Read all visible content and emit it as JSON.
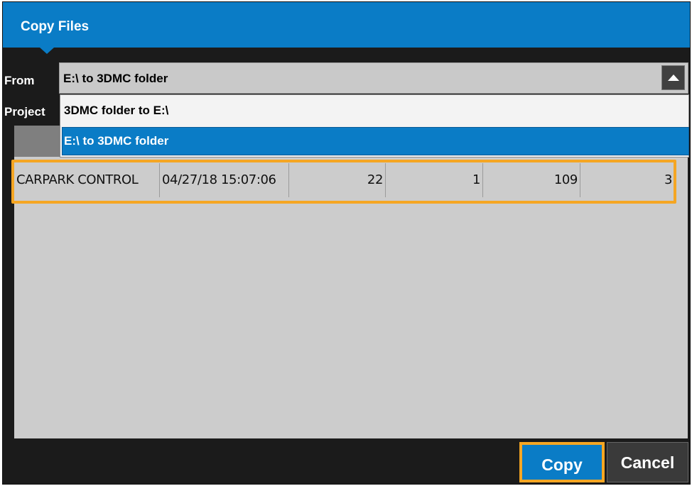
{
  "window": {
    "title": "Copy Files"
  },
  "from": {
    "label": "From",
    "selected_value": "E:\\ to 3DMC folder",
    "options": [
      "3DMC folder to E:\\",
      "E:\\ to 3DMC folder"
    ]
  },
  "project": {
    "label": "Project"
  },
  "grid": {
    "rows": [
      {
        "name": "CARPARK CONTROL",
        "date": "04/27/18 15:07:06",
        "c3": "22",
        "c4": "1",
        "c5": "109",
        "c6": "3"
      }
    ]
  },
  "buttons": {
    "copy": "Copy",
    "cancel": "Cancel"
  },
  "colors": {
    "accent": "#0a7cc6",
    "highlight": "#f5a623",
    "background": "#1b1b1b"
  }
}
